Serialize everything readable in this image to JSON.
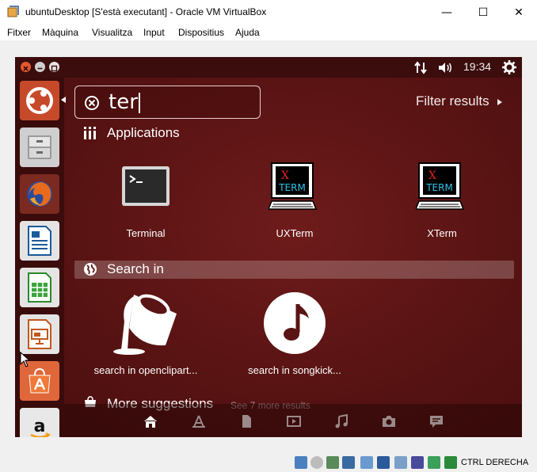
{
  "window": {
    "title": "ubuntuDesktop [S'està executant] - Oracle VM VirtualBox",
    "minimize": "—",
    "maximize": "☐",
    "close": "✕"
  },
  "menubar": [
    "Fitxer",
    "Màquina",
    "Visualitza",
    "Input",
    "Dispositius",
    "Ajuda"
  ],
  "panel": {
    "time": "19:34"
  },
  "dash": {
    "search_value": "ter",
    "filter_label": "Filter results",
    "applications_title": "Applications",
    "apps": [
      {
        "label": "Terminal"
      },
      {
        "label": "UXTerm",
        "icon_text_top": "X",
        "icon_text_bottom": "TERM"
      },
      {
        "label": "XTerm",
        "icon_text_top": "X",
        "icon_text_bottom": "TERM"
      }
    ],
    "search_in_title": "Search in",
    "search_items": [
      {
        "label": "search in openclipart..."
      },
      {
        "label": "search in songkick..."
      }
    ],
    "more_suggestions_title": "More suggestions",
    "more_suggestions_sub": "See 7 more results"
  },
  "launcher": [
    "ubuntu-dash",
    "files",
    "firefox",
    "writer",
    "calc",
    "impress",
    "software-center",
    "amazon"
  ],
  "statusbar": {
    "host_key": "CTRL DERECHA"
  },
  "colors": {
    "aubergine": "#5a1414",
    "panel": "#3b0d0d",
    "ubuntu_orange": "#dd4814"
  }
}
